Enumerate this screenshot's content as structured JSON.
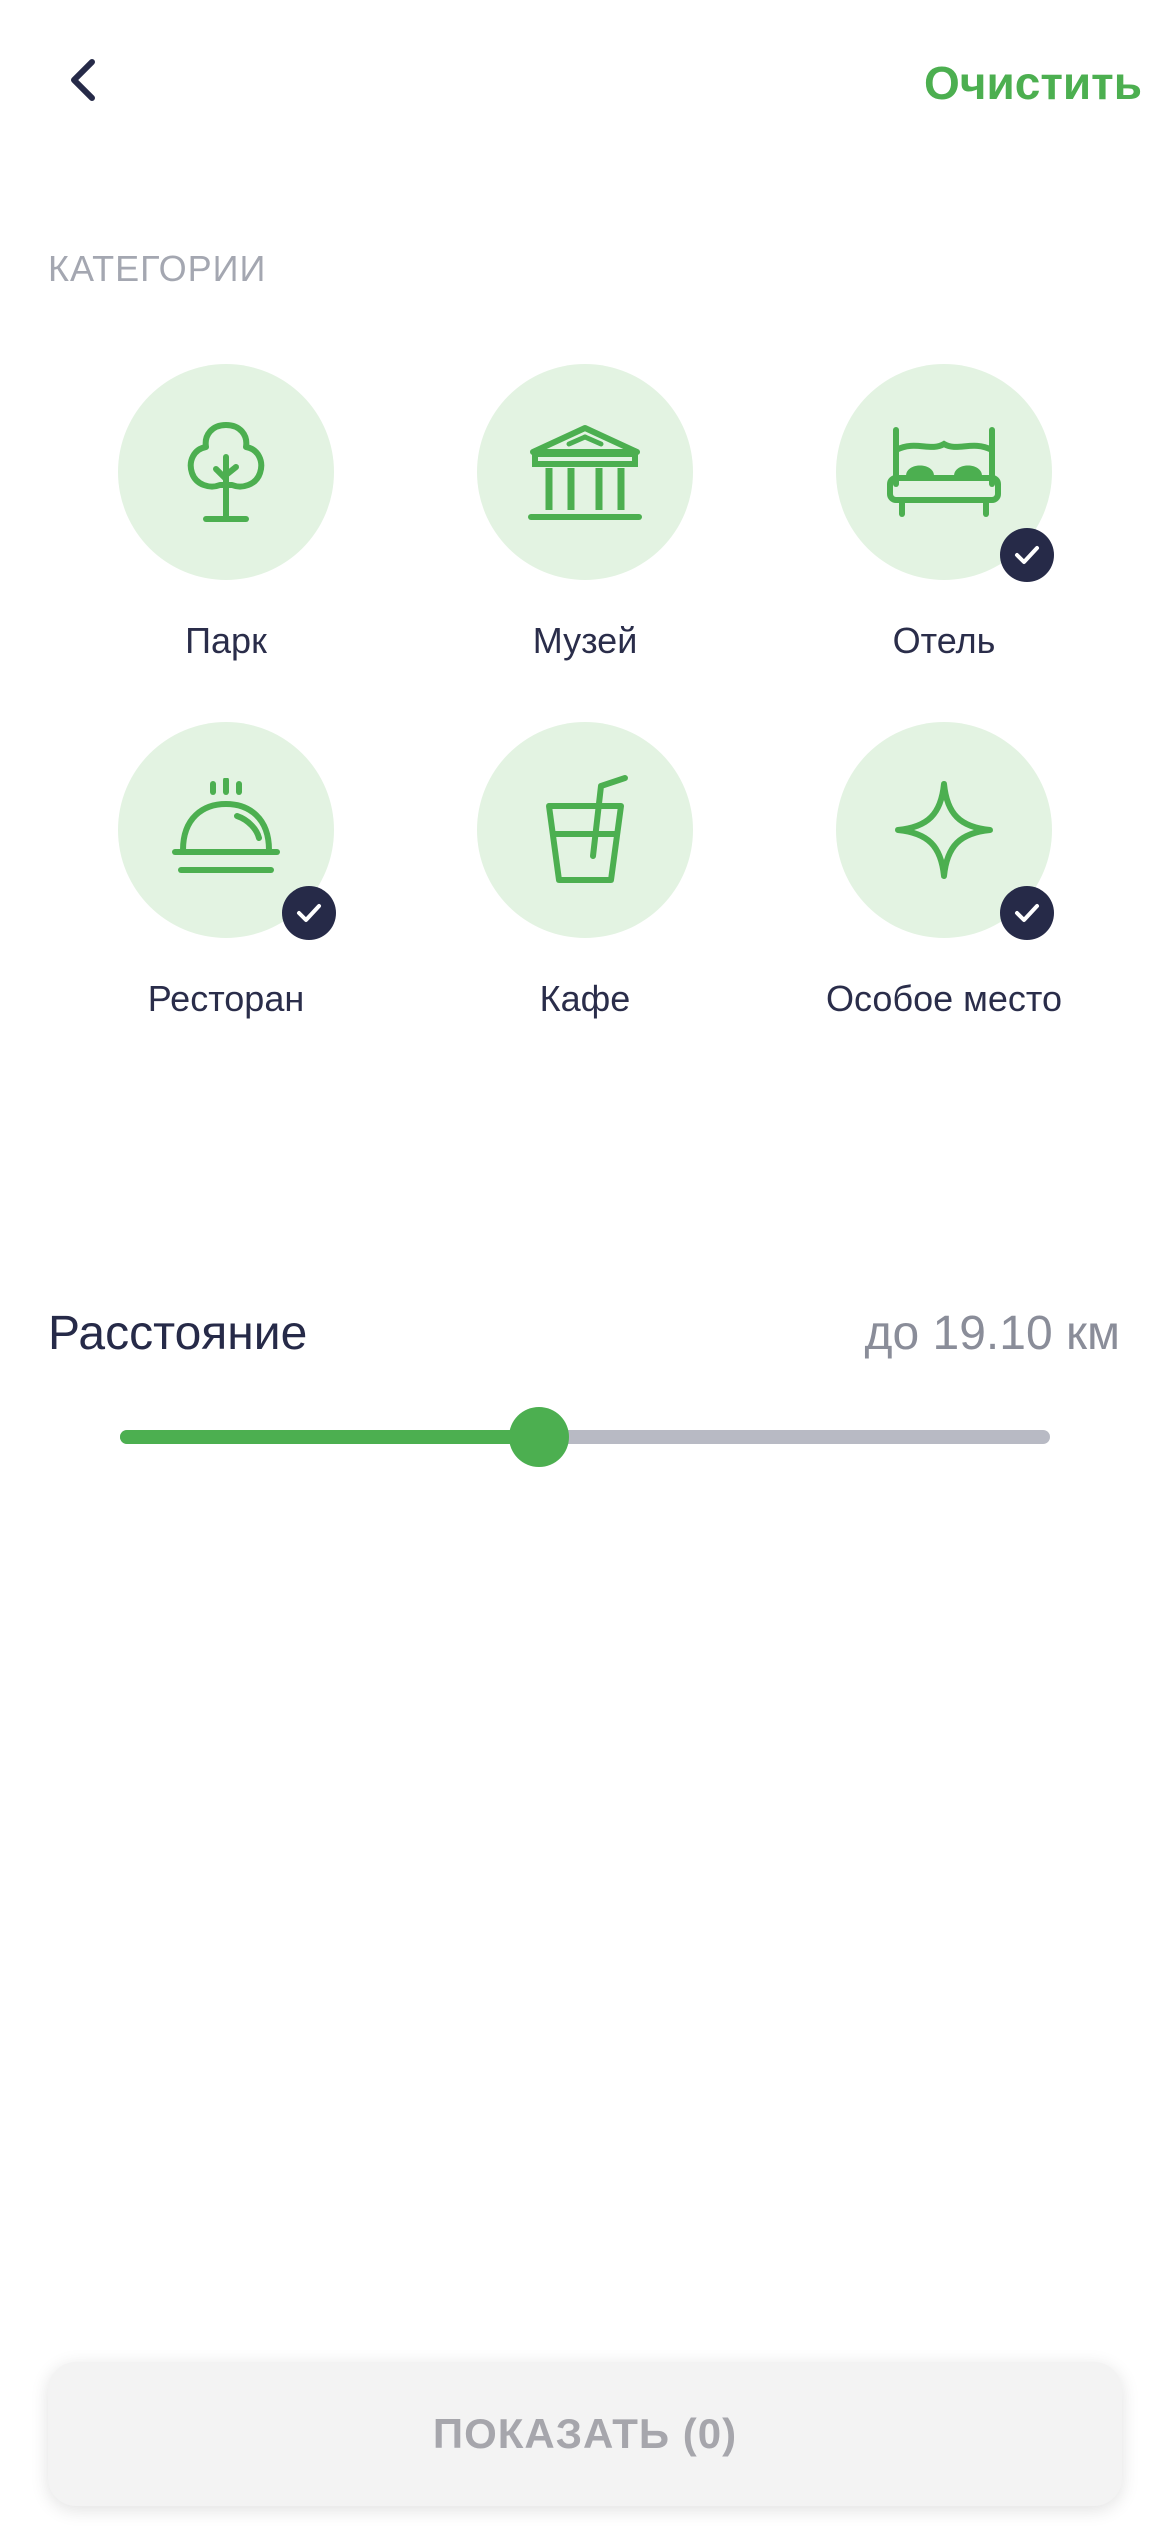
{
  "header": {
    "back_icon": "chevron-left-icon",
    "clear_label": "Очистить"
  },
  "categories": {
    "title": "КАТЕГОРИИ",
    "items": [
      {
        "label": "Парк",
        "icon": "tree-icon",
        "selected": false
      },
      {
        "label": "Музей",
        "icon": "museum-icon",
        "selected": false
      },
      {
        "label": "Отель",
        "icon": "bed-icon",
        "selected": true
      },
      {
        "label": "Ресторан",
        "icon": "cloche-icon",
        "selected": true
      },
      {
        "label": "Кафе",
        "icon": "drink-icon",
        "selected": false
      },
      {
        "label": "Особое место",
        "icon": "sparkle-icon",
        "selected": true
      }
    ]
  },
  "distance": {
    "label": "Расстояние",
    "value_text": "до 19.10 км",
    "slider_fraction": 0.45
  },
  "footer": {
    "show_button_label": "ПОКАЗАТЬ (0)"
  },
  "colors": {
    "accent": "#4CAF50",
    "circle_bg": "#E3F3E2",
    "dark": "#262A48",
    "track": "#B8BAC4"
  }
}
